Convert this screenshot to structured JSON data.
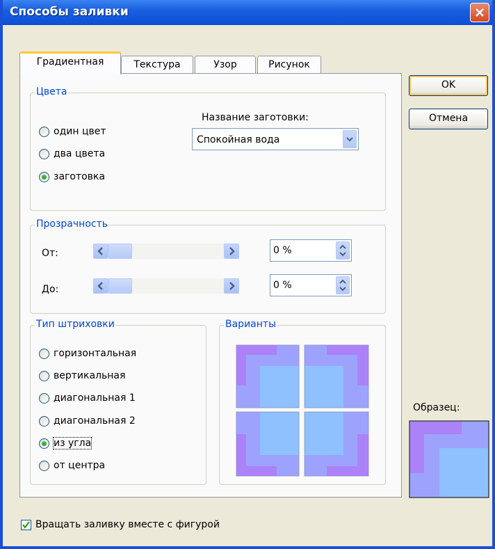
{
  "window": {
    "title": "Способы заливки"
  },
  "tabs": [
    {
      "label": "Градиентная",
      "active": true
    },
    {
      "label": "Текстура",
      "active": false
    },
    {
      "label": "Узор",
      "active": false
    },
    {
      "label": "Рисунок",
      "active": false
    }
  ],
  "buttons": {
    "ok": "OK",
    "cancel": "Отмена"
  },
  "colors_group": {
    "legend": "Цвета",
    "options": [
      {
        "label": "один цвет",
        "selected": false
      },
      {
        "label": "два цвета",
        "selected": false
      },
      {
        "label": "заготовка",
        "selected": true
      }
    ],
    "preset_label": "Название заготовки:",
    "preset_value": "Спокойная вода"
  },
  "transparency_group": {
    "legend": "Прозрачность",
    "from_label": "От:",
    "to_label": "До:",
    "from_value": "0 %",
    "to_value": "0 %"
  },
  "hatch_group": {
    "legend": "Тип штриховки",
    "options": [
      {
        "label": "горизонтальная",
        "selected": false
      },
      {
        "label": "вертикальная",
        "selected": false
      },
      {
        "label": "диагональная 1",
        "selected": false
      },
      {
        "label": "диагональная 2",
        "selected": false
      },
      {
        "label": "из угла",
        "selected": true
      },
      {
        "label": "от центра",
        "selected": false
      }
    ]
  },
  "variants_group": {
    "legend": "Варианты"
  },
  "sample": {
    "label": "Образец:"
  },
  "rotate_checkbox": {
    "label": "Вращать заливку вместе с фигурой",
    "checked": true
  },
  "colors": {
    "title_bar": "#0e4ed6",
    "group_legend": "#0046d5",
    "gradient_blue": "#8fc0ff",
    "gradient_purple": "#b66df5"
  }
}
